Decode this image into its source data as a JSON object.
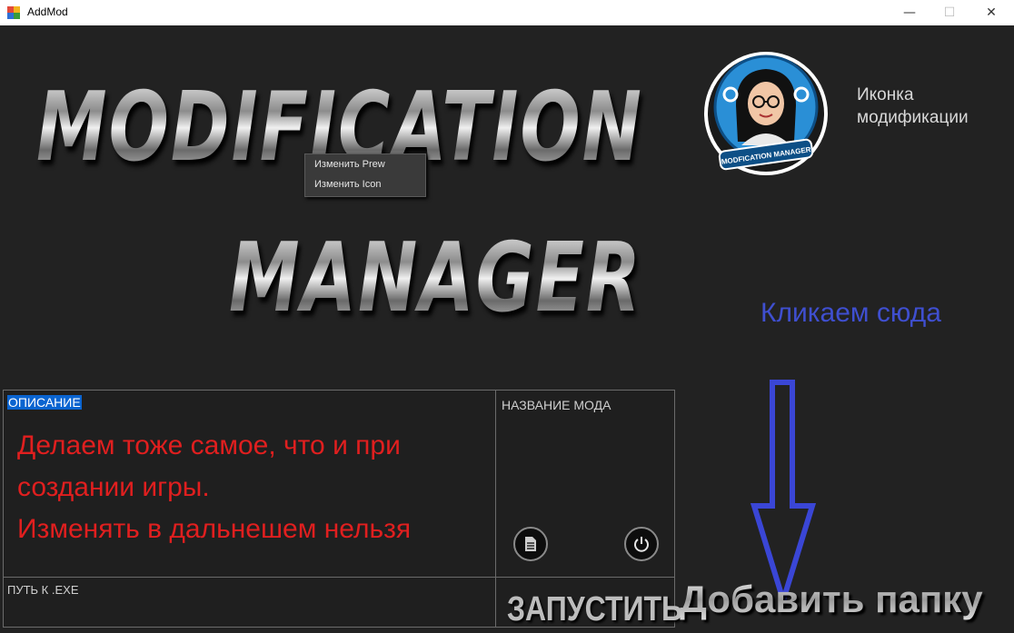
{
  "window": {
    "title": "AddMod",
    "minimize": "—",
    "maximize": "☐",
    "close": "✕"
  },
  "logo": {
    "line1": "MODIFICATION",
    "line2": "MANAGER"
  },
  "context_menu": {
    "items": [
      "Изменить Prew",
      "Изменить Icon"
    ]
  },
  "mod_icon": {
    "badge_text": "MODFICATION MANAGER",
    "label": "Иконка модификации"
  },
  "hint": {
    "text": "Кликаем сюда",
    "color": "#3f4fd0"
  },
  "description": {
    "label": "ОПИСАНИЕ",
    "lines": [
      "Делаем тоже самое, что и при",
      "создании игры.",
      "Изменять в дальнешем нельзя"
    ],
    "color": "#e01f1f"
  },
  "mod_name": {
    "label": "НАЗВАНИЕ МОДА"
  },
  "buttons": {
    "doc_icon": "document-icon",
    "power_icon": "power-icon",
    "run": "ЗАПУСТИТЬ",
    "add_folder": "Добавить папку"
  },
  "exe_path": {
    "label": "ПУТЬ К .EXE"
  }
}
